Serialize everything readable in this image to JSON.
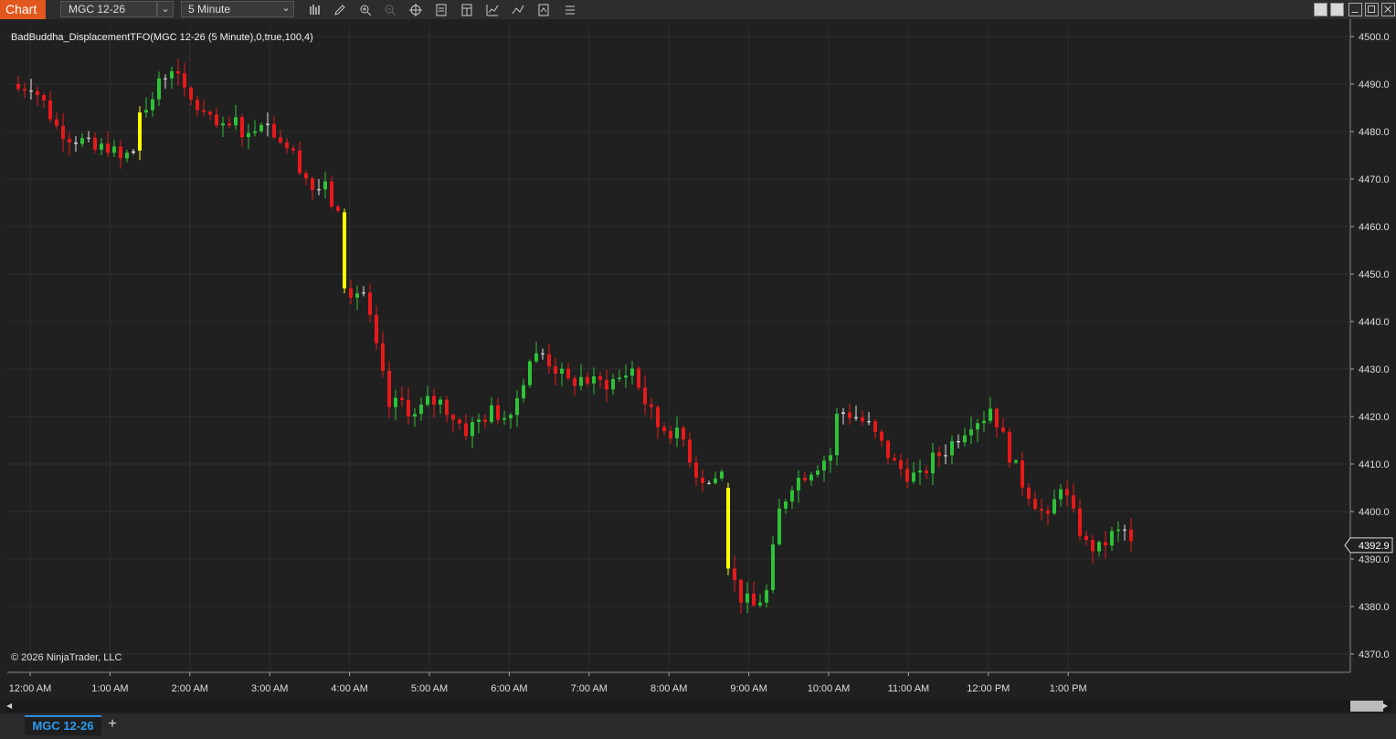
{
  "toolbar": {
    "title": "Chart",
    "instrument": "MGC 12-26",
    "interval": "5 Minute",
    "tool_icons": [
      "bar-style-icon",
      "draw-pencil-icon",
      "zoom-in-icon",
      "zoom-out-icon",
      "crosshair-icon",
      "data-box-icon",
      "templates-icon",
      "strategies-icon",
      "indicators-icon",
      "properties-icon",
      "menu-icon"
    ]
  },
  "indicator_label": "BadBuddha_DisplacementTFO(MGC 12-26 (5 Minute),0,true,100,4)",
  "copyright": "© 2026 NinjaTrader, LLC",
  "tab_label": "MGC 12-26",
  "colors": {
    "up": "#2ec238",
    "down": "#e8191a",
    "displacement": "#ffff00",
    "doji": "#e0e0e0",
    "background": "#202020",
    "grid": "#2e2e2e",
    "accent": "#e2571e"
  },
  "chart_data": {
    "type": "candlestick",
    "y_axis": {
      "min": 4365,
      "max": 4502,
      "tick_labels": [
        "4500.0",
        "4490.0",
        "4480.0",
        "4470.0",
        "4460.0",
        "4450.0",
        "4440.0",
        "4430.0",
        "4420.0",
        "4410.0",
        "4400.0",
        "4390.0",
        "4380.0",
        "4370.0"
      ]
    },
    "x_axis": {
      "tick_labels": [
        "12:00 AM",
        "1:00 AM",
        "2:00 AM",
        "3:00 AM",
        "4:00 AM",
        "5:00 AM",
        "6:00 AM",
        "7:00 AM",
        "8:00 AM",
        "9:00 AM",
        "10:00 AM",
        "11:00 AM",
        "12:00 PM",
        "1:00 PM"
      ]
    },
    "last_price": "4392.9",
    "close_path": [
      [
        0,
        4489
      ],
      [
        2,
        4490
      ],
      [
        4,
        4486
      ],
      [
        6,
        4481
      ],
      [
        8,
        4479
      ],
      [
        10,
        4478
      ],
      [
        12,
        4476
      ],
      [
        14,
        4477
      ],
      [
        16,
        4474
      ],
      [
        18,
        4476
      ],
      [
        19,
        4476
      ],
      [
        20,
        4484
      ],
      [
        22,
        4490
      ],
      [
        24,
        4494
      ],
      [
        26,
        4488
      ],
      [
        28,
        4485
      ],
      [
        30,
        4482
      ],
      [
        32,
        4480
      ],
      [
        34,
        4482
      ],
      [
        36,
        4479
      ],
      [
        38,
        4483
      ],
      [
        40,
        4480
      ],
      [
        42,
        4477
      ],
      [
        44,
        4473
      ],
      [
        46,
        4468
      ],
      [
        48,
        4468
      ],
      [
        50,
        4462
      ],
      [
        51,
        4447
      ],
      [
        54,
        4446
      ],
      [
        56,
        4434
      ],
      [
        58,
        4422
      ],
      [
        60,
        4423
      ],
      [
        62,
        4420
      ],
      [
        64,
        4423
      ],
      [
        66,
        4423
      ],
      [
        68,
        4420
      ],
      [
        70,
        4417
      ],
      [
        72,
        4419
      ],
      [
        74,
        4421
      ],
      [
        76,
        4420
      ],
      [
        78,
        4424
      ],
      [
        80,
        4432
      ],
      [
        82,
        4433
      ],
      [
        84,
        4430
      ],
      [
        86,
        4427
      ],
      [
        88,
        4428
      ],
      [
        90,
        4427
      ],
      [
        92,
        4427
      ],
      [
        94,
        4428
      ],
      [
        96,
        4430
      ],
      [
        98,
        4423
      ],
      [
        100,
        4418
      ],
      [
        102,
        4417
      ],
      [
        104,
        4415
      ],
      [
        106,
        4408
      ],
      [
        108,
        4406
      ],
      [
        110,
        4408
      ],
      [
        111,
        4388
      ],
      [
        113,
        4382
      ],
      [
        115,
        4380
      ],
      [
        117,
        4383
      ],
      [
        119,
        4400
      ],
      [
        121,
        4406
      ],
      [
        123,
        4408
      ],
      [
        125,
        4410
      ],
      [
        127,
        4412
      ],
      [
        128,
        4420
      ],
      [
        129,
        4421
      ],
      [
        131,
        4420
      ],
      [
        133,
        4418
      ],
      [
        135,
        4414
      ],
      [
        137,
        4410
      ],
      [
        139,
        4408
      ],
      [
        141,
        4407
      ],
      [
        143,
        4411
      ],
      [
        145,
        4413
      ],
      [
        147,
        4416
      ],
      [
        149,
        4419
      ],
      [
        151,
        4420
      ],
      [
        152,
        4422
      ],
      [
        153,
        4419
      ],
      [
        155,
        4412
      ],
      [
        157,
        4406
      ],
      [
        159,
        4402
      ],
      [
        161,
        4398
      ],
      [
        163,
        4406
      ],
      [
        165,
        4399
      ],
      [
        167,
        4393
      ],
      [
        169,
        4392
      ],
      [
        171,
        4395
      ],
      [
        173,
        4396
      ],
      [
        174,
        4392.9
      ]
    ],
    "displacement_bars": [
      [
        19,
        4476,
        4484
      ],
      [
        51,
        4463,
        4447
      ],
      [
        111,
        4405,
        4388
      ]
    ]
  }
}
